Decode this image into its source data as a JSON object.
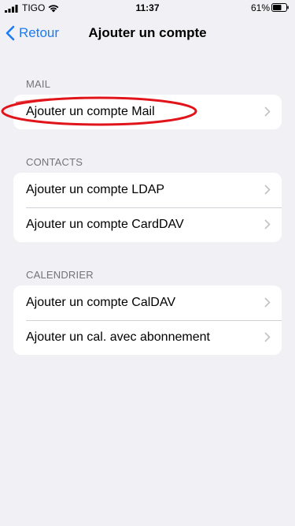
{
  "status_bar": {
    "carrier": "TIGO",
    "time": "11:37",
    "battery_percent": "61%"
  },
  "nav": {
    "back_label": "Retour",
    "title": "Ajouter un compte"
  },
  "sections": {
    "mail": {
      "header": "MAIL",
      "items": [
        {
          "label": "Ajouter un compte Mail"
        }
      ]
    },
    "contacts": {
      "header": "CONTACTS",
      "items": [
        {
          "label": "Ajouter un compte LDAP"
        },
        {
          "label": "Ajouter un compte CardDAV"
        }
      ]
    },
    "calendrier": {
      "header": "CALENDRIER",
      "items": [
        {
          "label": "Ajouter un compte CalDAV"
        },
        {
          "label": "Ajouter un cal. avec abonnement"
        }
      ]
    }
  },
  "icons": {
    "signal": "cellular-signal-icon",
    "wifi": "wifi-icon",
    "battery": "battery-icon",
    "back": "chevron-left-icon",
    "row_disclosure": "chevron-right-icon"
  },
  "colors": {
    "accent": "#1b7cf5",
    "background": "#f0f0f5",
    "highlight": "#e0141a"
  }
}
